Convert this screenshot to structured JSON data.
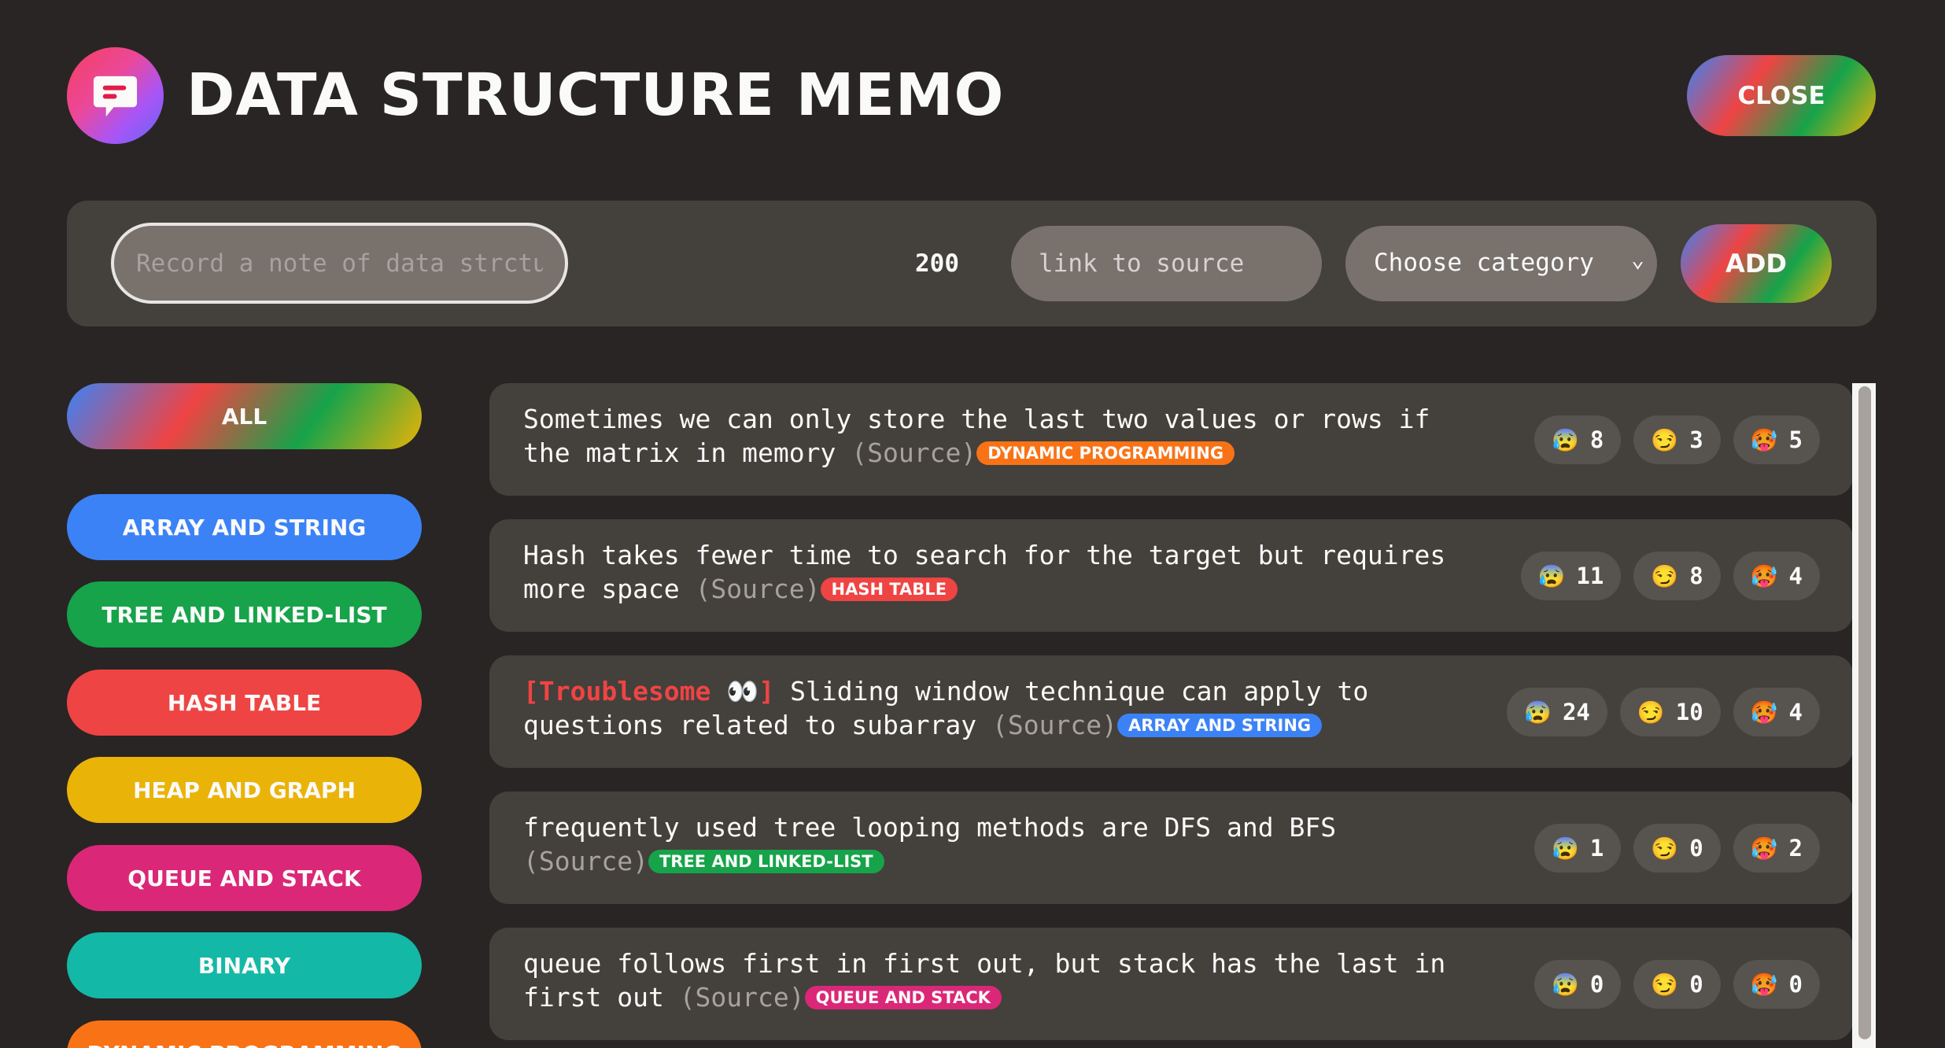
{
  "header": {
    "title": "Data Structure Memo",
    "close_label": "Close"
  },
  "form": {
    "note_placeholder": "Record a note of data strcture or algorithms",
    "char_count": "200",
    "source_placeholder": "link to source",
    "category_selected": "Choose category",
    "add_label": "Add"
  },
  "categories": [
    {
      "name": "All",
      "color": "gradient"
    },
    {
      "name": "Array and String",
      "color": "#3b82f6"
    },
    {
      "name": "Tree and Linked-list",
      "color": "#16a34a"
    },
    {
      "name": "Hash Table",
      "color": "#ef4444"
    },
    {
      "name": "Heap and Graph",
      "color": "#eab308"
    },
    {
      "name": "Queue and Stack",
      "color": "#db2777"
    },
    {
      "name": "Binary",
      "color": "#14b8a6"
    },
    {
      "name": "Dynamic Programming",
      "color": "#f97316"
    }
  ],
  "facts": [
    {
      "disputed_label": "",
      "text": "Sometimes we can only store the last two values or rows if the matrix in memory",
      "source_label": "(Source)",
      "category": "Dynamic Programming",
      "category_color": "#f97316",
      "votes": [
        {
          "emoji": "😰",
          "count": "8"
        },
        {
          "emoji": "😏",
          "count": "3"
        },
        {
          "emoji": "🥵",
          "count": "5"
        }
      ]
    },
    {
      "disputed_label": "",
      "text": "Hash takes fewer time to search for the target but requires more space",
      "source_label": "(Source)",
      "category": "Hash Table",
      "category_color": "#ef4444",
      "votes": [
        {
          "emoji": "😰",
          "count": "11"
        },
        {
          "emoji": "😏",
          "count": "8"
        },
        {
          "emoji": "🥵",
          "count": "4"
        }
      ]
    },
    {
      "disputed_label": "[Troublesome 👀]",
      "text": "Sliding window technique can apply to questions related to subarray",
      "source_label": "(Source)",
      "category": "Array and String",
      "category_color": "#3b82f6",
      "votes": [
        {
          "emoji": "😰",
          "count": "24"
        },
        {
          "emoji": "😏",
          "count": "10"
        },
        {
          "emoji": "🥵",
          "count": "4"
        }
      ]
    },
    {
      "disputed_label": "",
      "text": "frequently used tree looping methods are DFS and BFS",
      "source_label": "(Source)",
      "category": "Tree and Linked-list",
      "category_color": "#16a34a",
      "votes": [
        {
          "emoji": "😰",
          "count": "1"
        },
        {
          "emoji": "😏",
          "count": "0"
        },
        {
          "emoji": "🥵",
          "count": "2"
        }
      ]
    },
    {
      "disputed_label": "",
      "text": "queue follows first in first out, but stack has the last in first out",
      "source_label": "(Source)",
      "category": "Queue and Stack",
      "category_color": "#db2777",
      "votes": [
        {
          "emoji": "😰",
          "count": "0"
        },
        {
          "emoji": "😏",
          "count": "0"
        },
        {
          "emoji": "🥵",
          "count": "0"
        }
      ]
    }
  ]
}
